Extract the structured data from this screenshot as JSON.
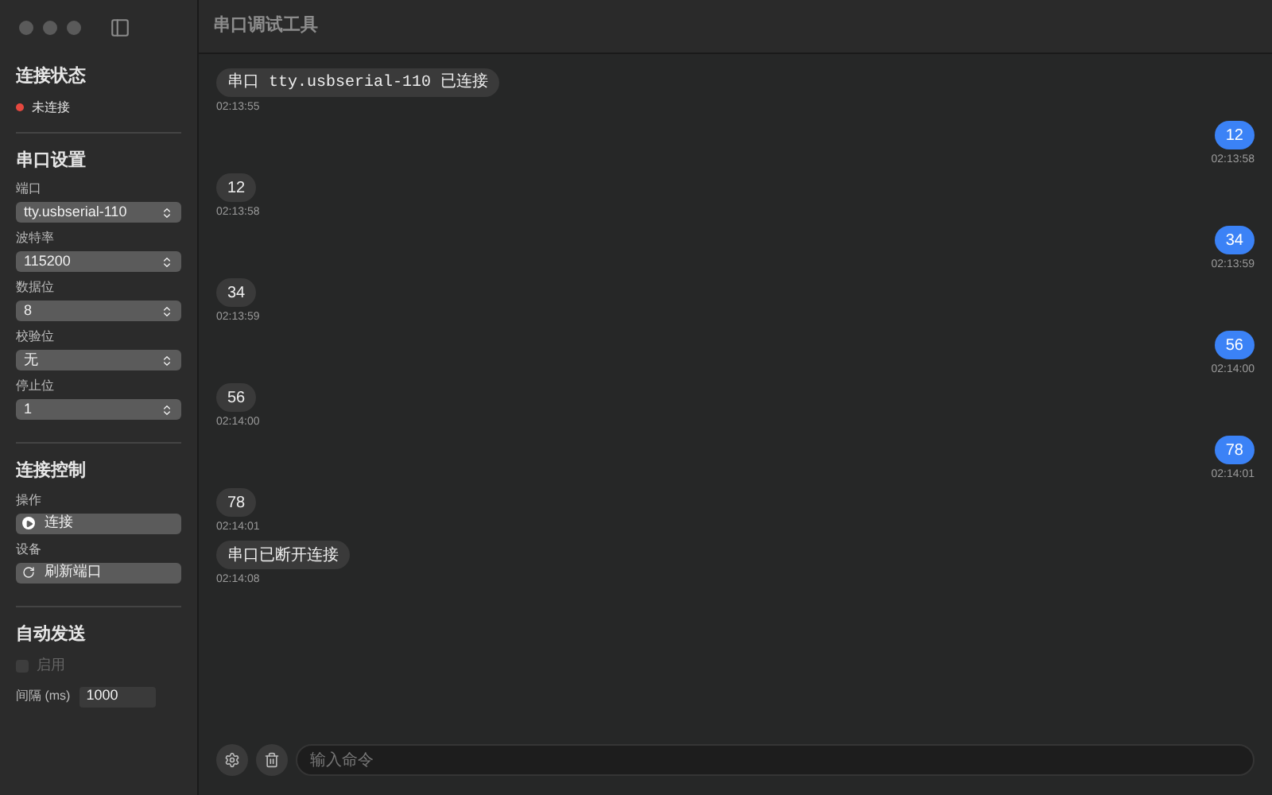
{
  "window": {
    "title": "串口调试工具"
  },
  "status": {
    "heading": "连接状态",
    "text": "未连接",
    "color": "#e5483f"
  },
  "serial": {
    "heading": "串口设置",
    "fields": [
      {
        "label": "端口",
        "value": "tty.usbserial-110"
      },
      {
        "label": "波特率",
        "value": "115200"
      },
      {
        "label": "数据位",
        "value": "8"
      },
      {
        "label": "校验位",
        "value": "无"
      },
      {
        "label": "停止位",
        "value": "1"
      }
    ]
  },
  "control": {
    "heading": "连接控制",
    "actions": [
      {
        "label": "操作",
        "button": "连接",
        "kind": "play"
      },
      {
        "label": "设备",
        "button": "刷新端口",
        "kind": "refresh"
      }
    ]
  },
  "auto_send": {
    "heading": "自动发送",
    "checkbox": {
      "label": "启用",
      "checked": false,
      "disabled": true
    },
    "interval_label": "间隔 (ms)",
    "interval": "1000"
  },
  "messages": [
    {
      "kind": "incoming",
      "mono": true,
      "text": "串口 tty.usbserial-110 已连接",
      "time": "02:13:55"
    },
    {
      "kind": "outgoing",
      "mono": false,
      "text": "12",
      "time": "02:13:58"
    },
    {
      "kind": "incoming",
      "mono": false,
      "text": "12",
      "time": "02:13:58"
    },
    {
      "kind": "outgoing",
      "mono": false,
      "text": "34",
      "time": "02:13:59"
    },
    {
      "kind": "incoming",
      "mono": false,
      "text": "34",
      "time": "02:13:59"
    },
    {
      "kind": "outgoing",
      "mono": false,
      "text": "56",
      "time": "02:14:00"
    },
    {
      "kind": "incoming",
      "mono": false,
      "text": "56",
      "time": "02:14:00"
    },
    {
      "kind": "outgoing",
      "mono": false,
      "text": "78",
      "time": "02:14:01"
    },
    {
      "kind": "incoming",
      "mono": false,
      "text": "78",
      "time": "02:14:01"
    },
    {
      "kind": "incoming",
      "mono": false,
      "text": "串口已断开连接",
      "time": "02:14:08"
    }
  ],
  "input": {
    "placeholder": "输入命令"
  }
}
